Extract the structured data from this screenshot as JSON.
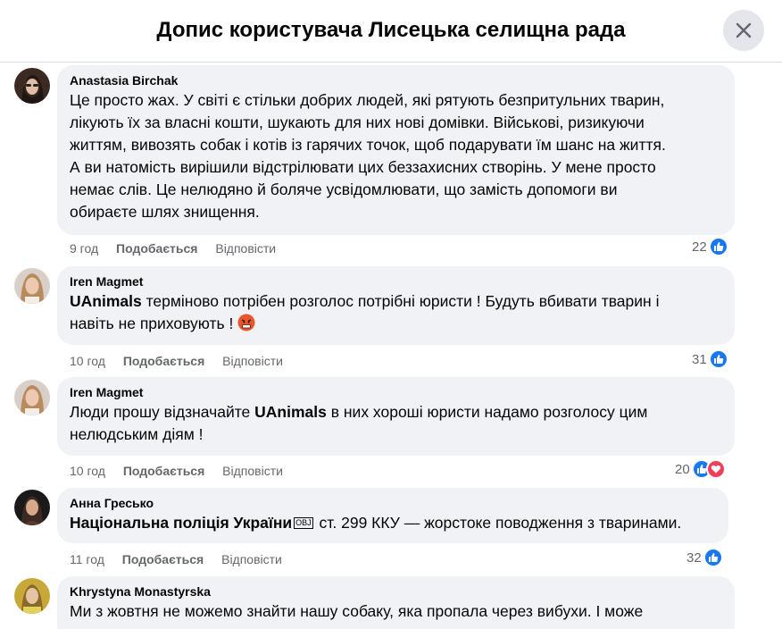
{
  "header": {
    "title": "Допис користувача Лисецька селищна рада"
  },
  "actions": {
    "like": "Подобається",
    "reply": "Відповісти"
  },
  "comments": [
    {
      "author": "Anastasia Birchak",
      "lines": [
        "Це просто жах. У світі є стільки добрих людей, які рятують безпритульних тварин,",
        "лікують їх за власні кошти, шукають для них нові домівки. Військові, ризикуючи",
        "життям, вивозять собак і котів із гарячих точок, щоб подарувати їм шанс на життя.",
        "А ви натомість вирішили відстрілювати цих беззахисних створінь. У мене просто",
        "немає слів. Це нелюдяно й боляче усвідомлювати, що замість допомоги ви",
        "обираєте шлях знищення."
      ],
      "time": "9 год",
      "reactions": 22,
      "reaction_types": [
        "like-icon"
      ]
    },
    {
      "author": "Iren Magmet",
      "mention": "UAnimals",
      "line1_rest": " терміново потрібен розголос потрібні юристи ! Будуть вбивати тварин і",
      "line2": "навіть не приховують ! ",
      "emoji": "angry-face",
      "time": "10 год",
      "reactions": 31,
      "reaction_types": [
        "like-icon"
      ]
    },
    {
      "author": "Iren Magmet",
      "line1_pre": "Люди прошу відзначайте ",
      "mention": "UAnimals",
      "line1_post": " в них хороші юристи надамо розголосу цим",
      "line2": "нелюдським діям !",
      "time": "10 год",
      "reactions": 20,
      "reaction_types": [
        "like-icon",
        "heart-icon"
      ]
    },
    {
      "author": "Анна Гресько",
      "mention": "Національна поліція України",
      "badge": "OBJ",
      "text_rest": " ст. 299 ККУ — жорстоке поводження з тваринами.",
      "time": "11 год",
      "reactions": 32,
      "reaction_types": [
        "like-icon"
      ]
    },
    {
      "author": "Khrystyna Monastyrska",
      "line1": "Ми з жовтня не можемо знайти нашу собаку, яка пропала через вибухи. І може"
    }
  ],
  "colors": {
    "like": "#1877f2",
    "love": "#f33e58",
    "bubble": "#f0f2f5",
    "meta": "#65676b"
  }
}
